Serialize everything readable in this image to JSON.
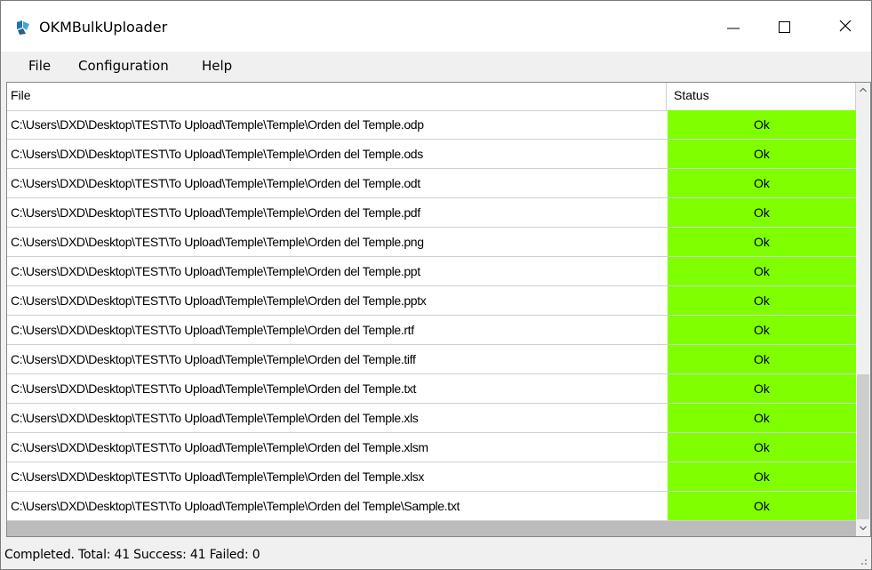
{
  "window": {
    "title": "OKMBulkUploader",
    "app_icon": "okm-logo-icon",
    "controls": [
      "minimize-icon",
      "maximize-icon",
      "close-icon"
    ]
  },
  "menu": {
    "items": [
      "File",
      "Configuration",
      "Help"
    ]
  },
  "grid": {
    "columns": [
      "File",
      "Status"
    ],
    "rows": [
      {
        "file": "C:\\Users\\DXD\\Desktop\\TEST\\To Upload\\Temple\\Temple\\Orden del Temple.odp",
        "status": "Ok"
      },
      {
        "file": "C:\\Users\\DXD\\Desktop\\TEST\\To Upload\\Temple\\Temple\\Orden del Temple.ods",
        "status": "Ok"
      },
      {
        "file": "C:\\Users\\DXD\\Desktop\\TEST\\To Upload\\Temple\\Temple\\Orden del Temple.odt",
        "status": "Ok"
      },
      {
        "file": "C:\\Users\\DXD\\Desktop\\TEST\\To Upload\\Temple\\Temple\\Orden del Temple.pdf",
        "status": "Ok"
      },
      {
        "file": "C:\\Users\\DXD\\Desktop\\TEST\\To Upload\\Temple\\Temple\\Orden del Temple.png",
        "status": "Ok"
      },
      {
        "file": "C:\\Users\\DXD\\Desktop\\TEST\\To Upload\\Temple\\Temple\\Orden del Temple.ppt",
        "status": "Ok"
      },
      {
        "file": "C:\\Users\\DXD\\Desktop\\TEST\\To Upload\\Temple\\Temple\\Orden del Temple.pptx",
        "status": "Ok"
      },
      {
        "file": "C:\\Users\\DXD\\Desktop\\TEST\\To Upload\\Temple\\Temple\\Orden del Temple.rtf",
        "status": "Ok"
      },
      {
        "file": "C:\\Users\\DXD\\Desktop\\TEST\\To Upload\\Temple\\Temple\\Orden del Temple.tiff",
        "status": "Ok"
      },
      {
        "file": "C:\\Users\\DXD\\Desktop\\TEST\\To Upload\\Temple\\Temple\\Orden del Temple.txt",
        "status": "Ok"
      },
      {
        "file": "C:\\Users\\DXD\\Desktop\\TEST\\To Upload\\Temple\\Temple\\Orden del Temple.xls",
        "status": "Ok"
      },
      {
        "file": "C:\\Users\\DXD\\Desktop\\TEST\\To Upload\\Temple\\Temple\\Orden del Temple.xlsm",
        "status": "Ok"
      },
      {
        "file": "C:\\Users\\DXD\\Desktop\\TEST\\To Upload\\Temple\\Temple\\Orden del Temple.xlsx",
        "status": "Ok"
      },
      {
        "file": "C:\\Users\\DXD\\Desktop\\TEST\\To Upload\\Temple\\Temple\\Orden del Temple\\Sample.txt",
        "status": "Ok"
      }
    ],
    "ok_color": "#7fff00"
  },
  "status_bar": {
    "text": "Completed.  Total: 41  Success: 41  Failed: 0"
  }
}
